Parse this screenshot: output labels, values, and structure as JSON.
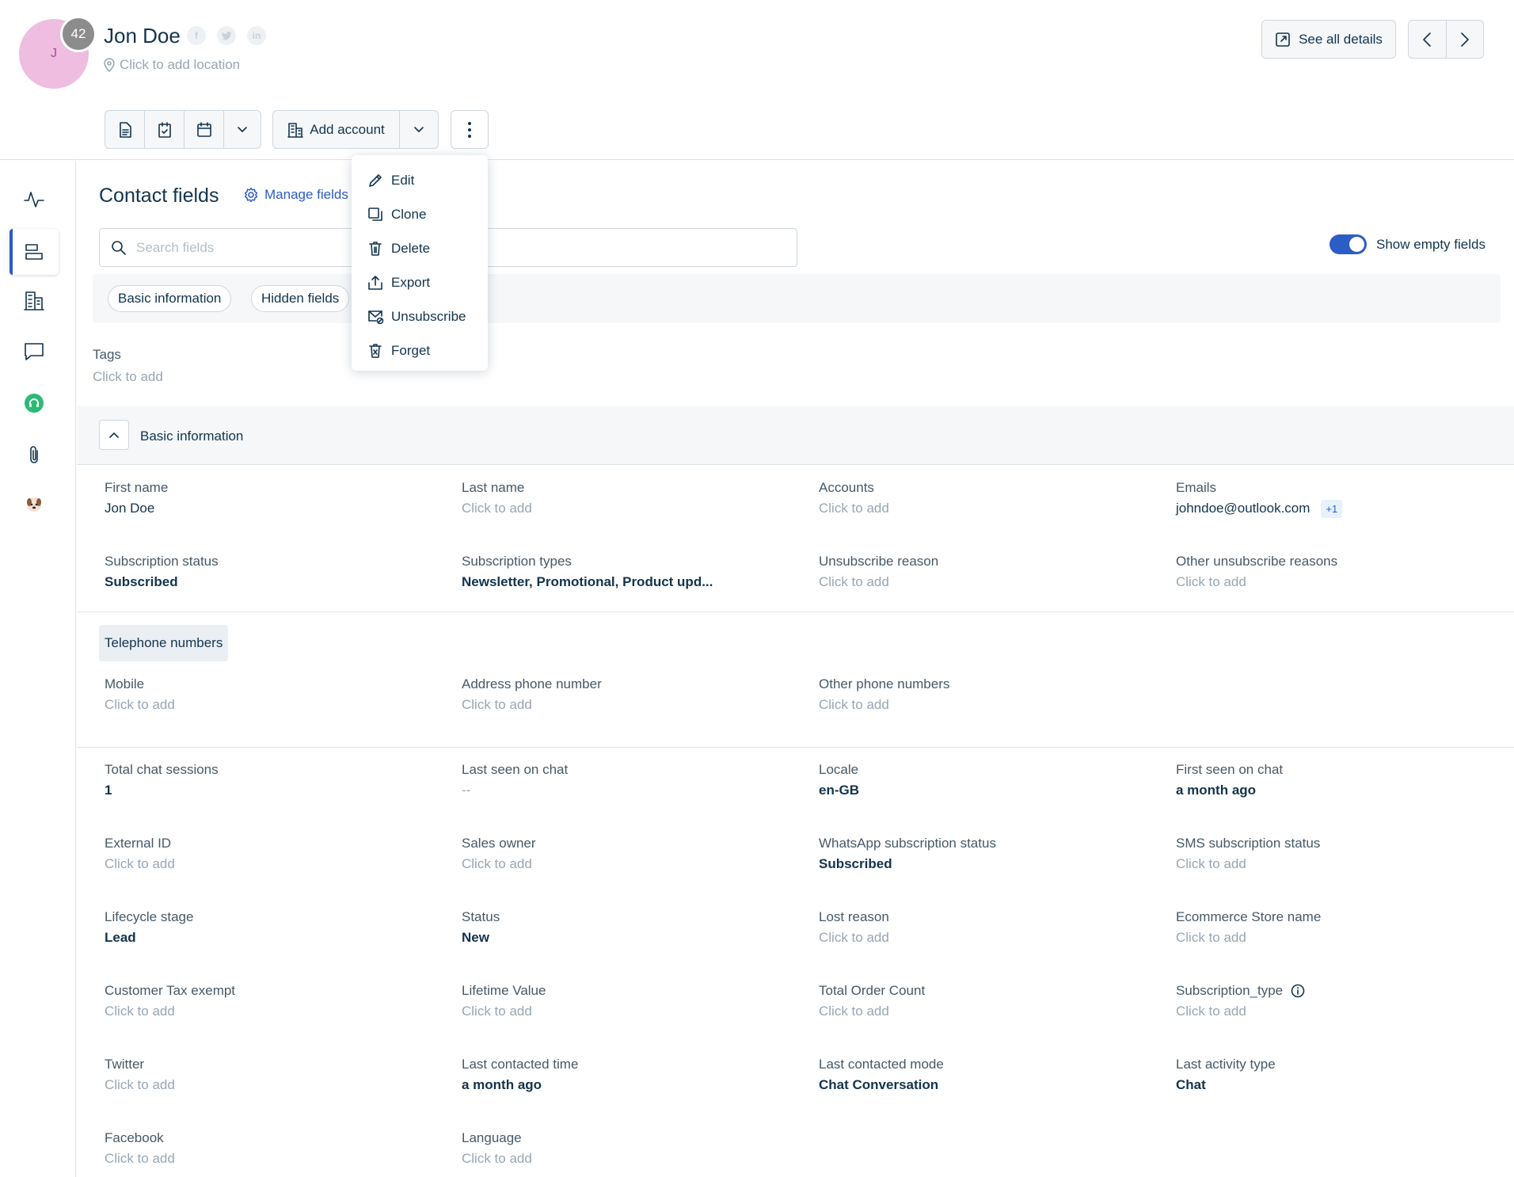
{
  "contact": {
    "initial": "J",
    "score": "42",
    "name": "Jon Doe",
    "location_placeholder": "Click to add location",
    "socials": [
      "facebook-icon",
      "twitter-icon",
      "linkedin-icon"
    ]
  },
  "header": {
    "see_all_label": "See all details",
    "add_account_label": "Add account"
  },
  "menu": {
    "items": [
      {
        "label": "Edit",
        "icon": "pencil-icon"
      },
      {
        "label": "Clone",
        "icon": "clone-icon"
      },
      {
        "label": "Delete",
        "icon": "trash-icon"
      },
      {
        "label": "Export",
        "icon": "export-icon"
      },
      {
        "label": "Unsubscribe",
        "icon": "unsubscribe-icon"
      },
      {
        "label": "Forget",
        "icon": "forget-icon"
      }
    ]
  },
  "sidebar": {
    "items": [
      "activity-icon",
      "contact-fields-icon",
      "accounts-icon",
      "conversations-icon",
      "support-icon",
      "attachments-icon",
      "dog-avatar-icon"
    ]
  },
  "main": {
    "title": "Contact fields",
    "manage_label": "Manage fields",
    "search_placeholder": "Search fields",
    "show_empty_label": "Show empty fields",
    "chips": [
      "Basic information",
      "Hidden fields"
    ],
    "tags_label": "Tags",
    "tags_value": "Click to add",
    "section_title": "Basic information",
    "telephone_label": "Telephone numbers",
    "emails_extra": "+1"
  },
  "fields": {
    "basic": [
      {
        "label": "First name",
        "value": "Jon Doe",
        "filled": true
      },
      {
        "label": "Last name",
        "value": "Click to add",
        "filled": false
      },
      {
        "label": "Accounts",
        "value": "Click to add",
        "filled": false
      },
      {
        "label": "Emails",
        "value": "johndoe@outlook.com",
        "filled": true
      },
      {
        "label": "Subscription status",
        "value": "Subscribed",
        "filled": true
      },
      {
        "label": "Subscription types",
        "value": "Newsletter, Promotional, Product upd...",
        "filled": true
      },
      {
        "label": "Unsubscribe reason",
        "value": "Click to add",
        "filled": false
      },
      {
        "label": "Other unsubscribe reasons",
        "value": "Click to add",
        "filled": false
      }
    ],
    "phones": [
      {
        "label": "Mobile",
        "value": "Click to add",
        "filled": false
      },
      {
        "label": "Address phone number",
        "value": "Click to add",
        "filled": false
      },
      {
        "label": "Other phone numbers",
        "value": "Click to add",
        "filled": false
      }
    ],
    "other": [
      {
        "label": "Total chat sessions",
        "value": "1",
        "filled": true
      },
      {
        "label": "Last seen on chat",
        "value": "--",
        "filled": false
      },
      {
        "label": "Locale",
        "value": "en-GB",
        "filled": true
      },
      {
        "label": "First seen on chat",
        "value": "a month ago",
        "filled": true
      },
      {
        "label": "External ID",
        "value": "Click to add",
        "filled": false
      },
      {
        "label": "Sales owner",
        "value": "Click to add",
        "filled": false
      },
      {
        "label": "WhatsApp subscription status",
        "value": "Subscribed",
        "filled": true
      },
      {
        "label": "SMS subscription status",
        "value": "Click to add",
        "filled": false
      },
      {
        "label": "Lifecycle stage",
        "value": "Lead",
        "filled": true
      },
      {
        "label": "Status",
        "value": "New",
        "filled": true
      },
      {
        "label": "Lost reason",
        "value": "Click to add",
        "filled": false
      },
      {
        "label": "Ecommerce Store name",
        "value": "Click to add",
        "filled": false
      },
      {
        "label": "Customer Tax exempt",
        "value": "Click to add",
        "filled": false
      },
      {
        "label": "Lifetime Value",
        "value": "Click to add",
        "filled": false
      },
      {
        "label": "Total Order Count",
        "value": "Click to add",
        "filled": false
      },
      {
        "label": "Subscription_type",
        "value": "Click to add",
        "filled": false
      },
      {
        "label": "Twitter",
        "value": "Click to add",
        "filled": false
      },
      {
        "label": "Last contacted time",
        "value": "a month ago",
        "filled": true
      },
      {
        "label": "Last contacted mode",
        "value": "Chat Conversation",
        "filled": true
      },
      {
        "label": "Last activity type",
        "value": "Chat",
        "filled": true
      },
      {
        "label": "Facebook",
        "value": "Click to add",
        "filled": false
      },
      {
        "label": "Language",
        "value": "Click to add",
        "filled": false
      }
    ]
  },
  "colors": {
    "accent": "#2c5cc5",
    "avatar_bg": "#eebde0",
    "text": "#12344d",
    "muted": "#98a6b3"
  }
}
